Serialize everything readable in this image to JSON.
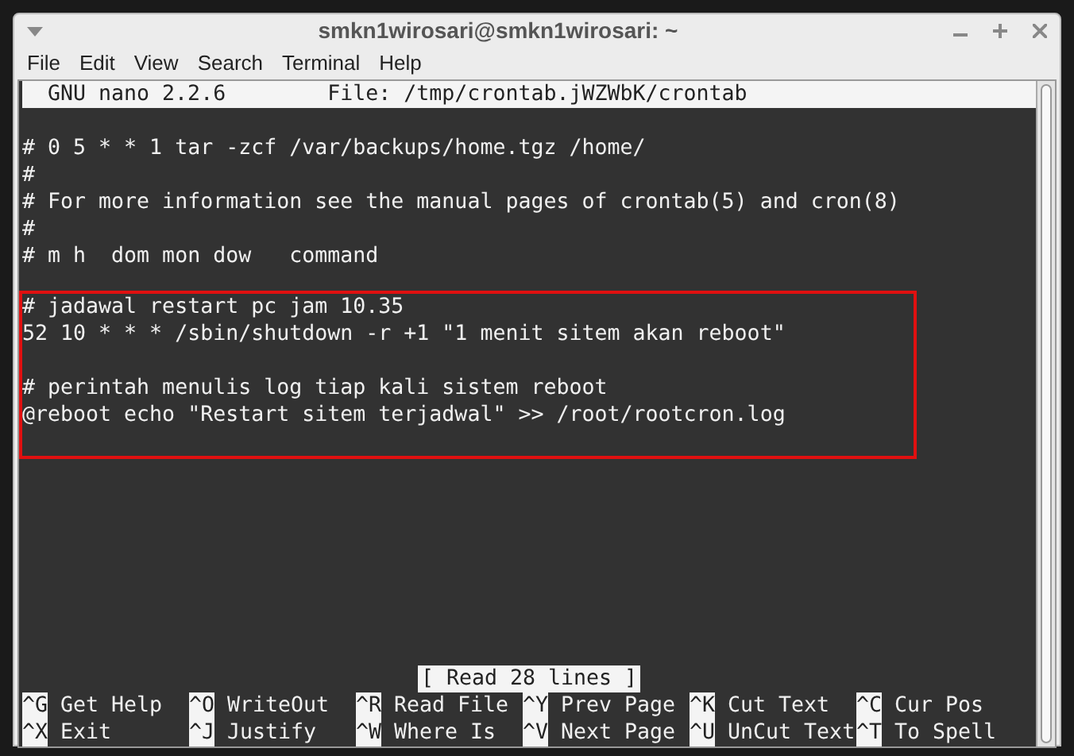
{
  "window": {
    "title": "smkn1wirosari@smkn1wirosari: ~"
  },
  "menu": [
    "File",
    "Edit",
    "View",
    "Search",
    "Terminal",
    "Help"
  ],
  "nano": {
    "version": "GNU nano 2.2.6",
    "file": "File: /tmp/crontab.jWZWbK/crontab"
  },
  "lines": [
    "# 0 5 * * 1 tar -zcf /var/backups/home.tgz /home/",
    "#",
    "# For more information see the manual pages of crontab(5) and cron(8)",
    "#",
    "# m h  dom mon dow   command"
  ],
  "highlighted_blocks": [
    [
      "# jadawal restart pc jam 10.35",
      "52 10 * * * /sbin/shutdown -r +1 \"1 menit sitem akan reboot\""
    ],
    [
      "# perintah menulis log tiap kali sistem reboot",
      "@reboot echo \"Restart sitem terjadwal\" >> /root/rootcron.log"
    ]
  ],
  "status": "[ Read 28 lines ]",
  "shortcuts": [
    [
      {
        "key": "^G",
        "label": "Get Help"
      },
      {
        "key": "^O",
        "label": "WriteOut"
      },
      {
        "key": "^R",
        "label": "Read File"
      },
      {
        "key": "^Y",
        "label": "Prev Page"
      },
      {
        "key": "^K",
        "label": "Cut Text"
      },
      {
        "key": "^C",
        "label": "Cur Pos"
      }
    ],
    [
      {
        "key": "^X",
        "label": "Exit"
      },
      {
        "key": "^J",
        "label": "Justify"
      },
      {
        "key": "^W",
        "label": "Where Is"
      },
      {
        "key": "^V",
        "label": "Next Page"
      },
      {
        "key": "^U",
        "label": "UnCut Text"
      },
      {
        "key": "^T",
        "label": "To Spell"
      }
    ]
  ]
}
